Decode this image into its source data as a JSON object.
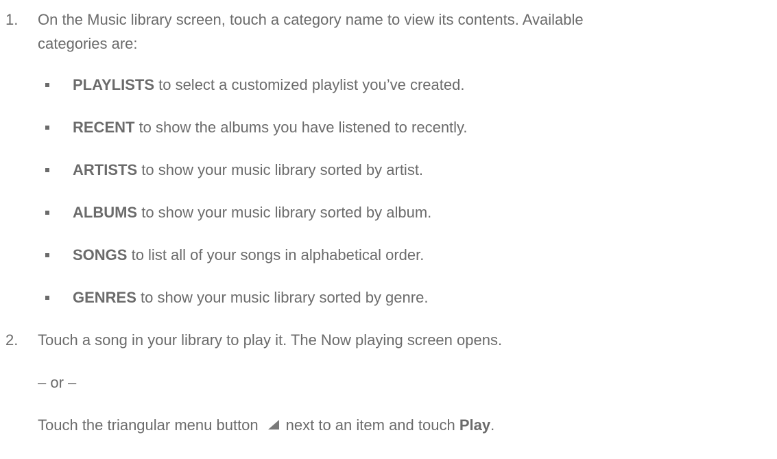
{
  "steps": [
    {
      "number": "1.",
      "line1": "On the Music library screen, touch a category name to view its contents. Available",
      "line2": "categories are:"
    },
    {
      "number": "2.",
      "text": "Touch a song in your library to play it. The Now playing screen opens."
    }
  ],
  "categories": [
    {
      "name": "PLAYLISTS",
      "desc": " to select a customized playlist you’ve created."
    },
    {
      "name": "RECENT",
      "desc": " to show the albums you have listened to recently."
    },
    {
      "name": "ARTISTS",
      "desc": " to show your music library sorted by artist."
    },
    {
      "name": "ALBUMS",
      "desc": " to show your music library sorted by album."
    },
    {
      "name": "SONGS",
      "desc": " to list all of your songs in alphabetical order."
    },
    {
      "name": "GENRES",
      "desc": " to show your music library sorted by genre."
    }
  ],
  "or_text": "– or –",
  "final": {
    "before": "Touch the triangular menu button",
    "icon": "triangle-menu-icon",
    "after": "next to an item and touch ",
    "bold": "Play",
    "end": "."
  }
}
